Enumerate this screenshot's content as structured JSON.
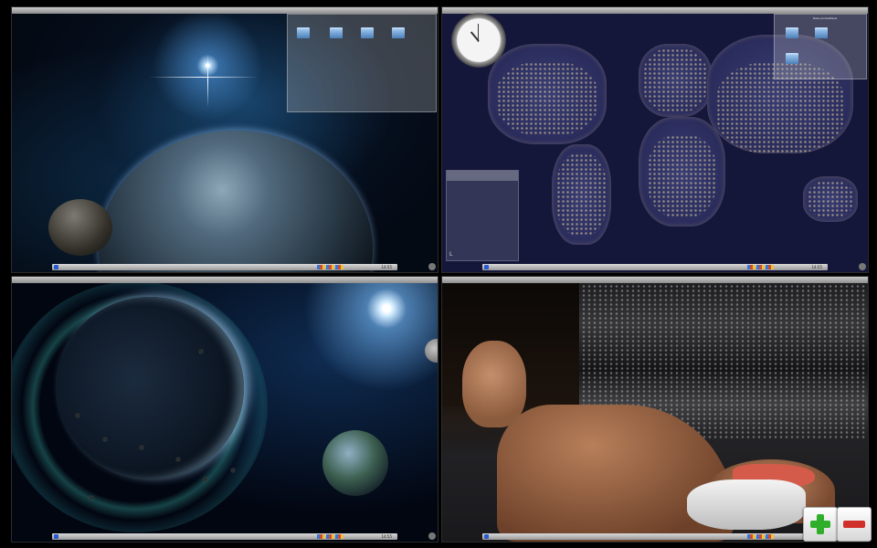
{
  "desktops": [
    {
      "id": "desktop-1",
      "label": "",
      "widget_folders": [
        "",
        "",
        "",
        ""
      ],
      "clock_text": "14:55"
    },
    {
      "id": "desktop-2",
      "label": "",
      "widget_title": "Rosa prometheus",
      "clock_text": "14:55"
    },
    {
      "id": "desktop-3",
      "label": "",
      "clock_text": "14:55"
    },
    {
      "id": "desktop-4",
      "label": "",
      "clock_text": "14:55"
    }
  ],
  "zoom_controls": {
    "zoom_in": "+",
    "zoom_out": "−"
  },
  "colors": {
    "zoom_in": "#2fae2a",
    "zoom_out": "#d1302a"
  }
}
